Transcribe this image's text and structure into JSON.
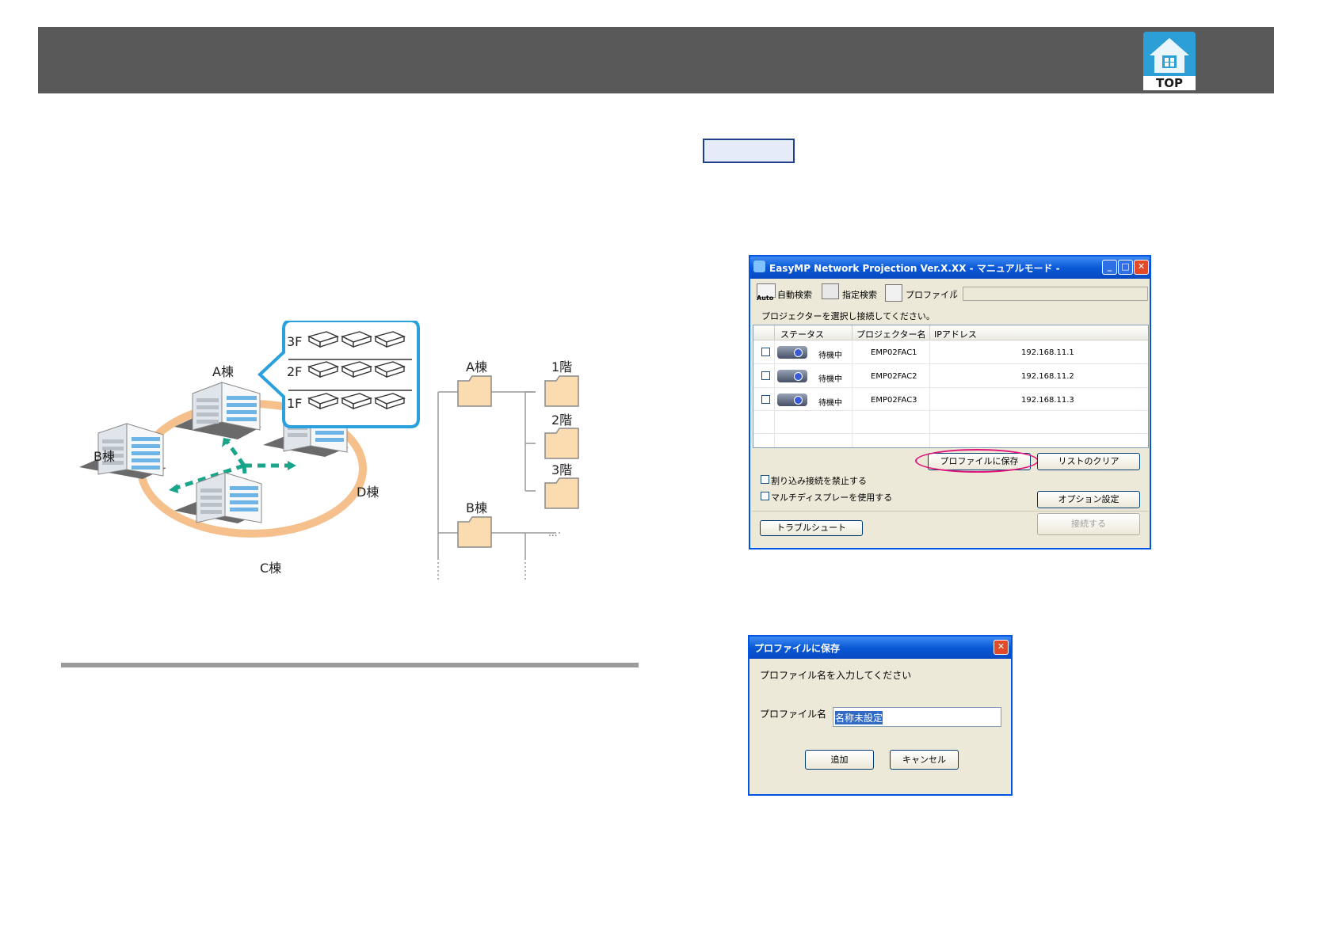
{
  "top_badge": {
    "label": "TOP"
  },
  "diagram": {
    "building_a": "A棟",
    "building_b": "B棟",
    "building_c": "C棟",
    "building_d": "D棟",
    "floors": [
      "3F",
      "2F",
      "1F"
    ],
    "tree": {
      "root_a": "A棟",
      "floor_1": "1階",
      "floor_2": "2階",
      "floor_3": "3階",
      "root_b": "B棟",
      "ellipsis": "..."
    }
  },
  "main_window": {
    "title": "EasyMP Network Projection Ver.X.XX - マニュアルモード -",
    "toolbar": {
      "auto_badge": "Auto",
      "auto_search": "自動検索",
      "specified_search": "指定検索",
      "profile": "プロファイル"
    },
    "instruction": "プロジェクターを選択し接続してください。",
    "columns": [
      "ステータス",
      "プロジェクター名",
      "IPアドレス"
    ],
    "rows": [
      {
        "status": "待機中",
        "name": "EMP02FAC1",
        "ip": "192.168.11.1"
      },
      {
        "status": "待機中",
        "name": "EMP02FAC2",
        "ip": "192.168.11.2"
      },
      {
        "status": "待機中",
        "name": "EMP02FAC3",
        "ip": "192.168.11.3"
      }
    ],
    "save_profile_button": "プロファイルに保存",
    "clear_list_button": "リストのクリア",
    "no_interrupt_label": "割り込み接続を禁止する",
    "multi_display_label": "マルチディスプレーを使用する",
    "option_button": "オプション設定",
    "troubleshoot_button": "トラブルシュート",
    "connect_button": "接続する"
  },
  "save_dialog": {
    "title": "プロファイルに保存",
    "prompt": "プロファイル名を入力してください",
    "name_label": "プロファイル名",
    "name_value": "名称未設定",
    "add_button": "追加",
    "cancel_button": "キャンセル"
  },
  "colors": {
    "header": "#595959",
    "accent_blue": "#2c9fd6",
    "ring": "#f5c08c",
    "arrow": "#1aa58a",
    "highlight": "#e0167a"
  }
}
